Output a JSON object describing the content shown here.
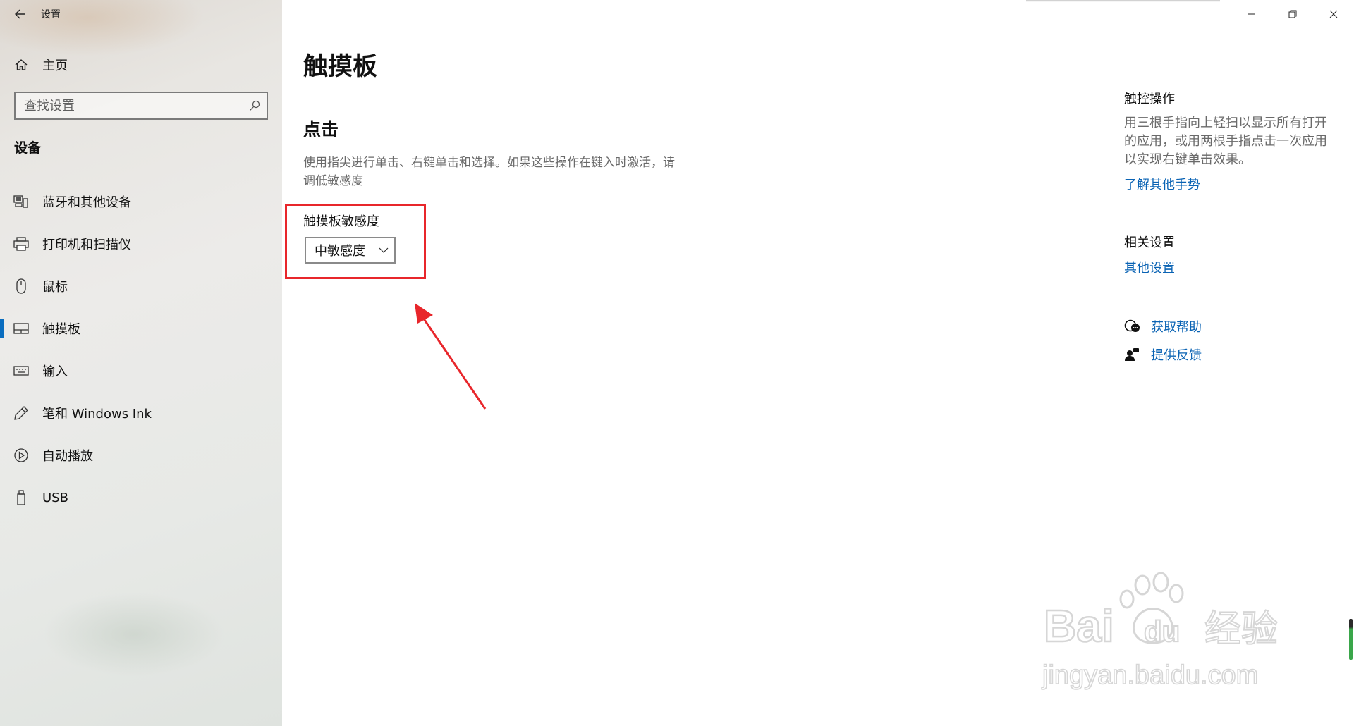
{
  "window": {
    "title": "设置"
  },
  "sidebar": {
    "home_label": "主页",
    "search_placeholder": "查找设置",
    "section_title": "设备",
    "items": [
      {
        "label": "蓝牙和其他设备",
        "icon": "bluetooth-devices-icon"
      },
      {
        "label": "打印机和扫描仪",
        "icon": "printer-icon"
      },
      {
        "label": "鼠标",
        "icon": "mouse-icon"
      },
      {
        "label": "触摸板",
        "icon": "touchpad-icon",
        "selected": true
      },
      {
        "label": "输入",
        "icon": "keyboard-icon"
      },
      {
        "label": "笔和 Windows Ink",
        "icon": "pen-icon"
      },
      {
        "label": "自动播放",
        "icon": "autoplay-icon"
      },
      {
        "label": "USB",
        "icon": "usb-icon"
      }
    ]
  },
  "main": {
    "page_title": "触摸板",
    "section_title": "点击",
    "description": "使用指尖进行单击、右键单击和选择。如果这些操作在键入时激活，请调低敏感度",
    "sensitivity_label": "触摸板敏感度",
    "sensitivity_value": "中敏感度"
  },
  "right_pane": {
    "touch_heading": "触控操作",
    "touch_desc": "用三根手指向上轻扫以显示所有打开的应用，或用两根手指点击一次应用以实现右键单击效果。",
    "touch_link": "了解其他手势",
    "related_heading": "相关设置",
    "related_link": "其他设置",
    "help_label": "获取帮助",
    "feedback_label": "提供反馈"
  },
  "annotation": {
    "highlight_color": "#e8262b"
  },
  "watermark": {
    "brand": "Bai",
    "brand_du": "du",
    "brand_cn": "经验",
    "site": "jingyan.baidu.com"
  },
  "colors": {
    "accent": "#0a6dbf",
    "link": "#0a63b4",
    "secondary_text": "#6a6a6a"
  }
}
